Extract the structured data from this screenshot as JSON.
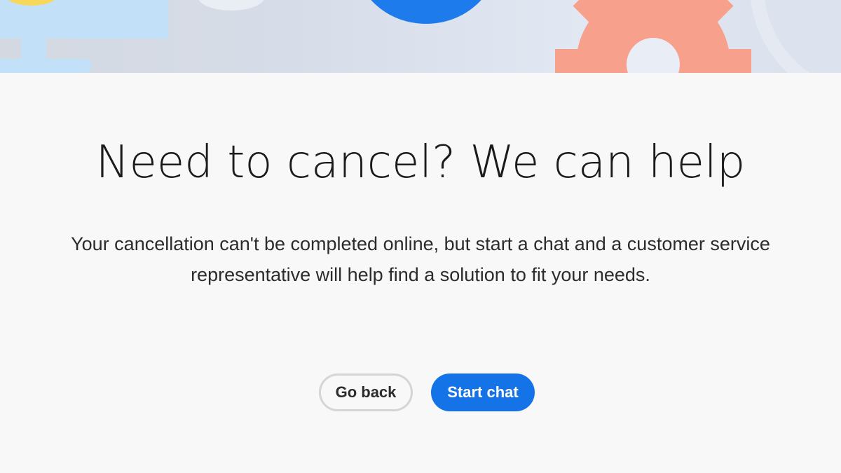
{
  "header_illustration": {
    "colors": {
      "background": "#d6dce8",
      "monitor": "#c2e1f9",
      "yellow_circle": "#f8d85a",
      "blue_circle": "#1e7bec",
      "gear": "#f7a08c",
      "light_shape": "#e9edf5"
    }
  },
  "main": {
    "heading": "Need to cancel? We can help",
    "description": "Your cancellation can't be completed online, but start a chat and a customer service representative will help find a solution to fit your needs."
  },
  "actions": {
    "go_back_label": "Go back",
    "start_chat_label": "Start chat"
  },
  "theme": {
    "accent": "#1473e6",
    "page_background": "#f8f8f8",
    "secondary_border": "#d5d5d5"
  }
}
